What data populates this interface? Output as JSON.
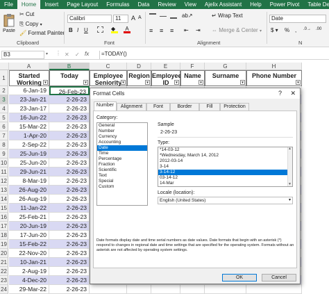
{
  "ribbon_tabs": [
    "File",
    "Home",
    "Insert",
    "Page Layout",
    "Formulas",
    "Data",
    "Review",
    "View",
    "Ajelix Assistant",
    "Help",
    "Power Pivot",
    "Table Desig"
  ],
  "clipboard": {
    "cut": "Cut",
    "copy": "Copy",
    "paste": "Paste",
    "format_painter": "Format Painter",
    "label": "Clipboard"
  },
  "font": {
    "name": "Calibri",
    "size": "11",
    "label": "Font",
    "bold": "B",
    "italic": "I",
    "underline": "U",
    "grow": "A",
    "shrink": "A"
  },
  "alignment": {
    "wrap": "Wrap Text",
    "merge": "Merge & Center",
    "label": "Alignment"
  },
  "number": {
    "format": "Date",
    "label": "N",
    "currency": "$",
    "percent": "%"
  },
  "formula_bar": {
    "name_box": "B3",
    "fx": "fx",
    "formula": "=TODAY()"
  },
  "columns": [
    "A",
    "B",
    "C",
    "D",
    "E",
    "F",
    "G",
    "H"
  ],
  "rows": [
    "1",
    "2",
    "3",
    "4",
    "5",
    "6",
    "7",
    "8",
    "9",
    "10",
    "11",
    "12",
    "13",
    "14",
    "15",
    "16",
    "17",
    "18",
    "19",
    "20",
    "21",
    "22",
    "23",
    "24"
  ],
  "headers": {
    "a": "Started Working",
    "b": "Today",
    "c": "Employee Seniority",
    "d": "Region",
    "e": "Employee ID",
    "f": "Name",
    "g": "Surname",
    "h": "Phone Number"
  },
  "col_a": [
    "6-Jan-19",
    "23-Jan-21",
    "23-Jan-17",
    "16-Jun-22",
    "15-Mar-22",
    "1-Apr-20",
    "2-Sep-22",
    "25-Jun-19",
    "25-Jun-20",
    "29-Jun-21",
    "8-Mar-19",
    "26-Aug-20",
    "26-Aug-19",
    "11-Jan-22",
    "25-Feb-21",
    "20-Jun-19",
    "17-Jun-20",
    "15-Feb-22",
    "22-Nov-20",
    "10-Jan-21",
    "2-Aug-19",
    "4-Dec-20",
    "29-Mar-22"
  ],
  "col_b": [
    "26-Feb-23",
    "2-26-23",
    "2-26-23",
    "2-26-23",
    "2-26-23",
    "2-26-23",
    "2-26-23",
    "2-26-23",
    "2-26-23",
    "2-26-23",
    "2-26-23",
    "2-26-23",
    "2-26-23",
    "2-26-23",
    "2-26-23",
    "2-26-23",
    "2-26-23",
    "2-26-23",
    "2-26-23",
    "2-26-23",
    "2-26-23",
    "2-26-23",
    "2-26-23"
  ],
  "dialog": {
    "title": "Format Cells",
    "help": "?",
    "close": "✕",
    "tabs": [
      "Number",
      "Alignment",
      "Font",
      "Border",
      "Fill",
      "Protection"
    ],
    "category_label": "Category:",
    "categories": [
      "General",
      "Number",
      "Currency",
      "Accounting",
      "Date",
      "Time",
      "Percentage",
      "Fraction",
      "Scientific",
      "Text",
      "Special",
      "Custom"
    ],
    "selected_category": 4,
    "sample_label": "Sample",
    "sample_value": "2-26-23",
    "type_label": "Type:",
    "types": [
      "*14-03-12",
      "*Wednesday, March 14, 2012",
      "2012-03-14",
      "3-14",
      "3-14-12",
      "03-14-12",
      "14-Mar"
    ],
    "selected_type": 4,
    "locale_label": "Locale (location):",
    "locale_value": "English (United States)",
    "description": "Date formats display date and time serial numbers as date values. Date formats that begin with an asterisk (*) respond to changes in regional date and time settings that are specified for the operating system. Formats without an asterisk are not affected by operating system settings.",
    "ok": "OK",
    "cancel": "Cancel"
  },
  "colors": {
    "excel_green": "#217346",
    "band": "#d9d9f3",
    "selection": "#0078d7"
  }
}
